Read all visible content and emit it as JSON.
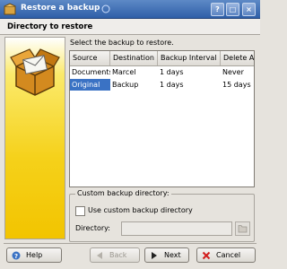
{
  "window": {
    "title": "Restore a backup",
    "buttons": [
      "?",
      "□",
      "×"
    ]
  },
  "header": {
    "title": "Directory to restore"
  },
  "instruction": "Select the backup to restore.",
  "table": {
    "columns": [
      "Source",
      "Destination",
      "Backup Interval",
      "Delete A"
    ],
    "rows": [
      [
        "Documents",
        "Marcel",
        "1 days",
        "Never"
      ],
      [
        "Original",
        "Backup",
        "1 days",
        "15 days"
      ]
    ],
    "selected_row": 1
  },
  "custom_dir": {
    "group_title": "Custom backup directory:",
    "checkbox_label": "Use custom backup directory",
    "checked": false,
    "directory_label": "Directory:",
    "directory_value": ""
  },
  "buttons": {
    "help": "Help",
    "back": "Back",
    "next": "Next",
    "cancel": "Cancel"
  },
  "colors": {
    "titlebar": "#2f5fa8",
    "selection": "#3a72c4",
    "panel": "#f5d11a"
  },
  "icons": [
    "backup-app-icon",
    "box-envelope-icon",
    "help-icon",
    "back-arrow-icon",
    "next-arrow-icon",
    "cancel-icon",
    "folder-open-icon"
  ]
}
